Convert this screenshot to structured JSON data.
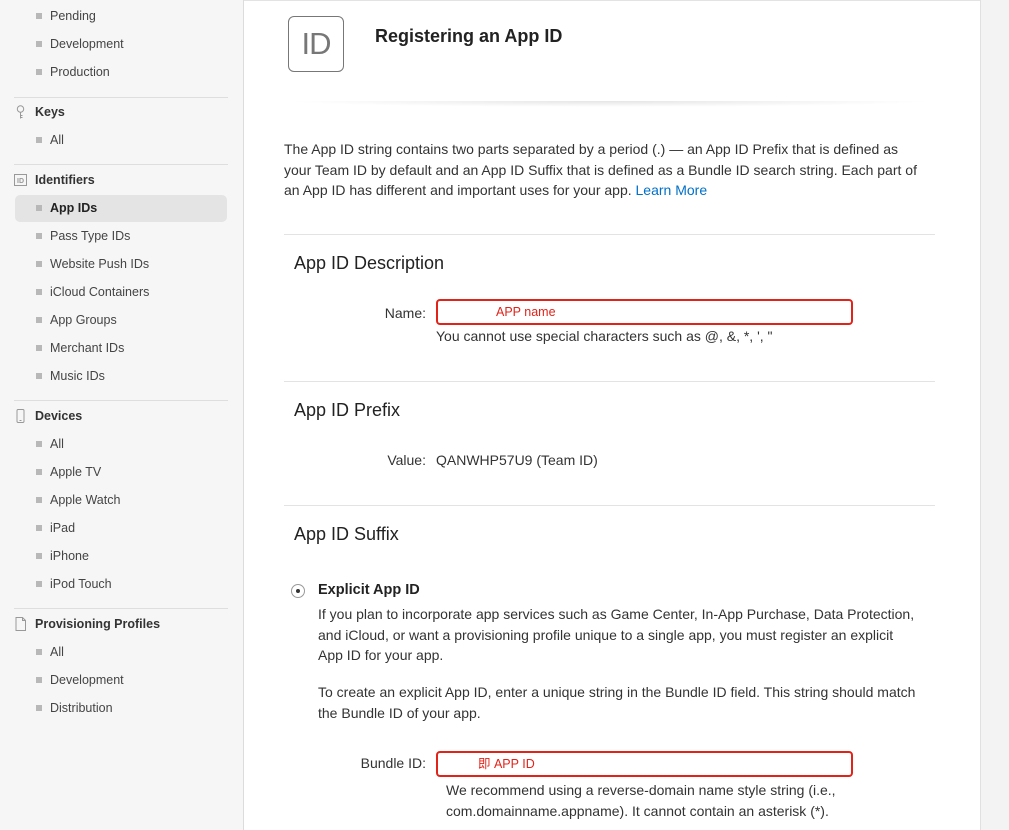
{
  "sidebar": {
    "certificates_items": [
      "Pending",
      "Development",
      "Production"
    ],
    "keys": {
      "title": "Keys",
      "items": [
        "All"
      ]
    },
    "identifiers": {
      "title": "Identifiers",
      "icon_text": "ID",
      "items": [
        "App IDs",
        "Pass Type IDs",
        "Website Push IDs",
        "iCloud Containers",
        "App Groups",
        "Merchant IDs",
        "Music IDs"
      ]
    },
    "devices": {
      "title": "Devices",
      "items": [
        "All",
        "Apple TV",
        "Apple Watch",
        "iPad",
        "iPhone",
        "iPod Touch"
      ]
    },
    "profiles": {
      "title": "Provisioning Profiles",
      "items": [
        "All",
        "Development",
        "Distribution"
      ]
    }
  },
  "header": {
    "icon_text": "ID",
    "title": "Registering an App ID"
  },
  "intro": {
    "text": "The App ID string contains two parts separated by a period (.) — an App ID Prefix that is defined as your Team ID by default and an App ID Suffix that is defined as a Bundle ID search string. Each part of an App ID has different and important uses for your app.",
    "link": "Learn More"
  },
  "description_section": {
    "title": "App ID Description",
    "name_label": "Name:",
    "name_value": "APP name",
    "hint": "You cannot use special characters such as @, &, *, ', \""
  },
  "prefix_section": {
    "title": "App ID Prefix",
    "value_label": "Value:",
    "value": "QANWHP57U9 (Team ID)"
  },
  "suffix_section": {
    "title": "App ID Suffix",
    "explicit_label": "Explicit App ID",
    "para1": "If you plan to incorporate app services such as Game Center, In-App Purchase, Data Protection, and iCloud, or want a provisioning profile unique to a single app, you must register an explicit App ID for your app.",
    "para2": "To create an explicit App ID, enter a unique string in the Bundle ID field. This string should match the Bundle ID of your app.",
    "bundle_label": "Bundle ID:",
    "bundle_value": "即 APP ID",
    "bundle_hint": "We recommend using a reverse-domain name style string (i.e., com.domainname.appname). It cannot contain an asterisk (*)."
  },
  "colors": {
    "accent_link": "#0070c9",
    "annotation_red": "#e2231a",
    "sidebar_bg": "#f6f6f6"
  }
}
